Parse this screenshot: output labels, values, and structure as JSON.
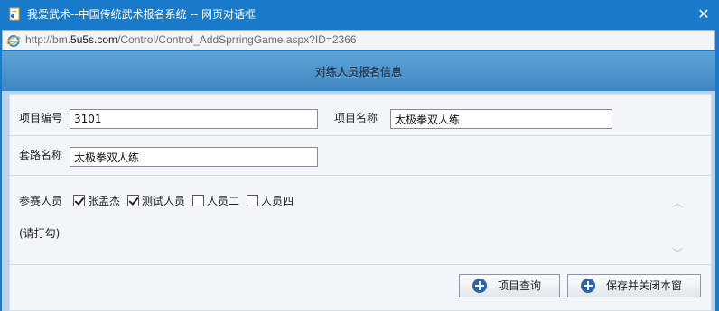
{
  "window": {
    "title": "我爱武术--中国传统武术报名系统 -- 网页对话框",
    "close_glyph": "✕",
    "url_prefix": "http://bm.",
    "url_domain": "5u5s.com",
    "url_path": "/Control/Control_AddSprringGame.aspx?ID=2366"
  },
  "header": {
    "title": "对练人员报名信息"
  },
  "form": {
    "project_no_label": "项目编号",
    "project_no_value": "3101",
    "project_name_label": "项目名称",
    "project_name_value": "太极拳双人练",
    "routine_name_label": "套路名称",
    "routine_name_value": "太极拳双人练",
    "participants_label": "参赛人员",
    "hint": "(请打勾)",
    "participants": [
      {
        "name": "张孟杰",
        "checked": true
      },
      {
        "name": "测试人员",
        "checked": true
      },
      {
        "name": "人员二",
        "checked": false
      },
      {
        "name": "人员四",
        "checked": false
      }
    ]
  },
  "scroll": {
    "up_glyph": "︿",
    "down_glyph": "﹀"
  },
  "buttons": {
    "query_label": "项目查询",
    "save_close_label": "保存并关闭本窗"
  },
  "colors": {
    "titlebar": "#1979ca",
    "header_band": "#4a8fc9",
    "button_icon": "#2a63a8"
  }
}
